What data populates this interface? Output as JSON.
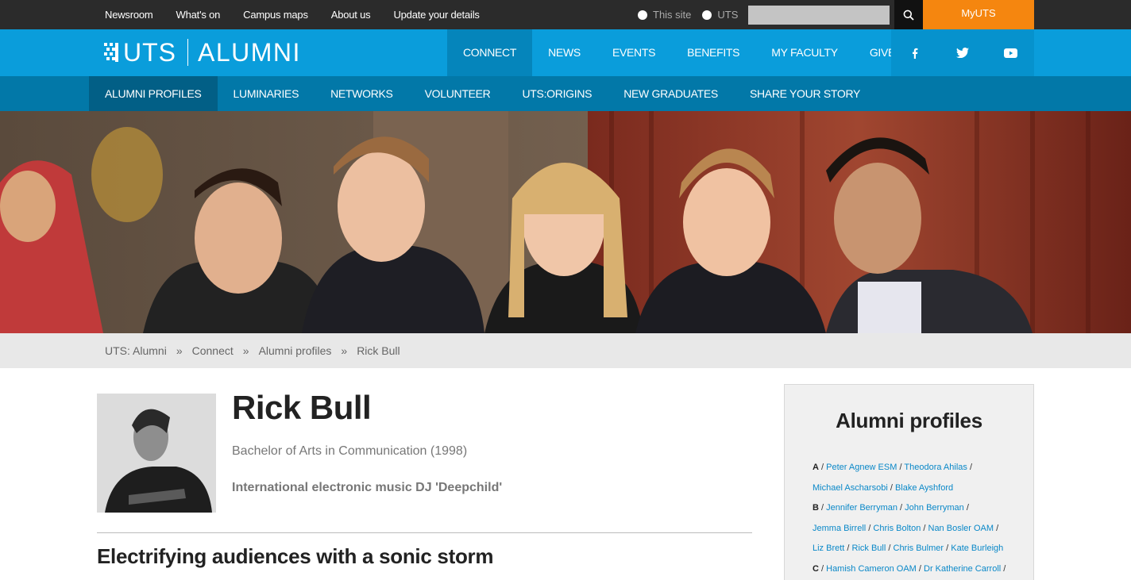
{
  "topbar": {
    "links": [
      "Newsroom",
      "What's on",
      "Campus maps",
      "About us",
      "Update your details"
    ],
    "radios": [
      "This site",
      "UTS"
    ],
    "search_placeholder": "",
    "myuts_label": "MyUTS"
  },
  "header": {
    "logo_uts": "UTS",
    "logo_alumni": "ALUMNI",
    "nav": [
      "CONNECT",
      "NEWS",
      "EVENTS",
      "BENEFITS",
      "MY FACULTY",
      "GIVE"
    ],
    "social_icons": [
      "facebook-icon",
      "twitter-icon",
      "youtube-icon"
    ]
  },
  "subnav": {
    "items": [
      "ALUMNI PROFILES",
      "LUMINARIES",
      "NETWORKS",
      "VOLUNTEER",
      "UTS:ORIGINS",
      "NEW GRADUATES",
      "SHARE YOUR STORY"
    ]
  },
  "breadcrumb": {
    "items": [
      "UTS: Alumni",
      "Connect",
      "Alumni profiles",
      "Rick Bull"
    ],
    "separator": "»"
  },
  "profile": {
    "name": "Rick Bull",
    "degree": "Bachelor of Arts in Communication (1998)",
    "tagline": "International electronic music DJ 'Deepchild'",
    "article_title": "Electrifying audiences with a sonic storm"
  },
  "sidebar": {
    "title": "Alumni profiles",
    "lines": [
      {
        "letter": "A",
        "names": [
          "Peter Agnew ESM",
          "Theodora Ahilas"
        ],
        "trailing": true
      },
      {
        "letter": "",
        "names": [
          "Michael Ascharsobi",
          "Blake Ayshford"
        ],
        "trailing": false
      },
      {
        "letter": "B",
        "names": [
          "Jennifer Berryman",
          "John Berryman"
        ],
        "trailing": true
      },
      {
        "letter": "",
        "names": [
          "Jemma Birrell",
          "Chris Bolton",
          "Nan Bosler OAM"
        ],
        "trailing": true
      },
      {
        "letter": "",
        "names": [
          "Liz Brett",
          "Rick Bull",
          "Chris Bulmer",
          "Kate Burleigh"
        ],
        "trailing": false
      },
      {
        "letter": "C",
        "names": [
          "Hamish Cameron OAM",
          "Dr Katherine Carroll"
        ],
        "trailing": true
      }
    ]
  },
  "colors": {
    "topbar": "#2b2b2b",
    "primary_blue": "#0a9ddb",
    "subnav_blue": "#0278a8",
    "myuts_orange": "#f5860f",
    "link_blue": "#0a88c8"
  }
}
